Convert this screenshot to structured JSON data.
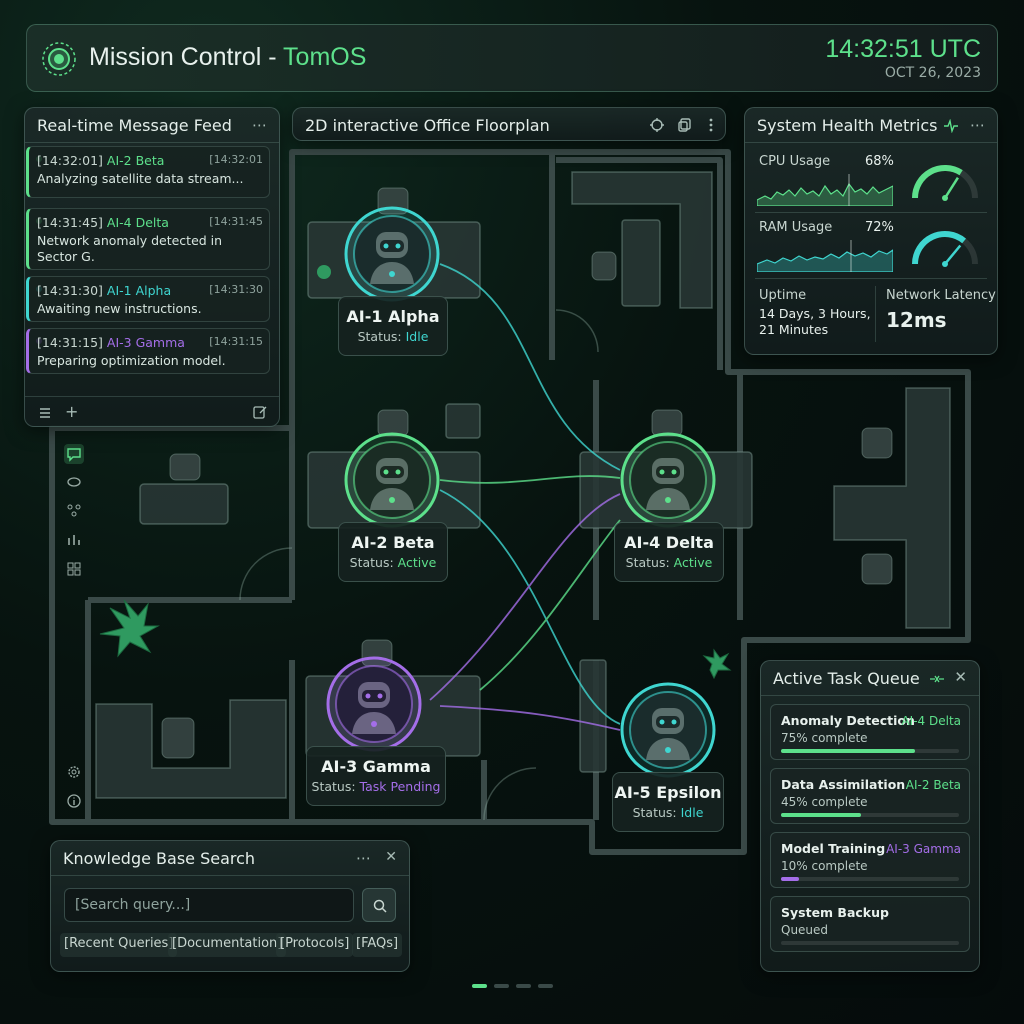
{
  "header": {
    "title_main": "Mission Control - ",
    "title_accent": "TomOS",
    "clock": "14:32:51 UTC",
    "date": "OCT 26, 2023"
  },
  "feed": {
    "title": "Real-time Message Feed",
    "items": [
      {
        "time": "[14:32:01]",
        "agent": "AI-2 Beta",
        "time_right": "[14:32:01",
        "text": "Analyzing satellite data stream...",
        "color": "#5de08b"
      },
      {
        "time": "[14:31:45]",
        "agent": "AI-4 Delta",
        "time_right": "[14:31:45",
        "text": "Network anomaly detected in Sector G.",
        "color": "#5de08b"
      },
      {
        "time": "[14:31:30]",
        "agent": "AI-1 Alpha",
        "time_right": "[14:31:30",
        "text": "Awaiting new instructions.",
        "color": "#3fd6d0"
      },
      {
        "time": "[14:31:15]",
        "agent": "AI-3 Gamma",
        "time_right": "[14:31:15",
        "text": "Preparing optimization model.",
        "color": "#a46ee8"
      }
    ]
  },
  "floorplan": {
    "title": "2D interactive Office Floorplan",
    "status_prefix": "Status: ",
    "agents": [
      {
        "name": "AI-1 Alpha",
        "status": "Idle",
        "color": "#3fd6d0"
      },
      {
        "name": "AI-2 Beta",
        "status": "Active",
        "color": "#5de08b"
      },
      {
        "name": "AI-4 Delta",
        "status": "Active",
        "color": "#5de08b"
      },
      {
        "name": "AI-3 Gamma",
        "status": "Task Pending",
        "color": "#a46ee8"
      },
      {
        "name": "AI-5 Epsilon",
        "status": "Idle",
        "color": "#3fd6d0"
      }
    ]
  },
  "health": {
    "title": "System Health Metrics",
    "cpu_label": "CPU Usage",
    "cpu_value": "68%",
    "cpu_level": 0.68,
    "ram_label": "RAM Usage",
    "ram_value": "72%",
    "ram_level": 0.72,
    "uptime_label": "Uptime",
    "uptime_value_1": "14 Days, 3 Hours,",
    "uptime_value_2": "21 Minutes",
    "latency_label": "Network Latency",
    "latency_value": "12ms"
  },
  "tasks": {
    "title": "Active Task Queue",
    "items": [
      {
        "name": "Anomaly Detection",
        "agent": "AI-4 Delta",
        "progress": "75% complete",
        "level": 0.75,
        "color": "#5de08b"
      },
      {
        "name": "Data Assimilation",
        "agent": "AI-2 Beta",
        "progress": "45% complete",
        "level": 0.45,
        "color": "#5de08b"
      },
      {
        "name": "Model Training",
        "agent": "AI-3 Gamma",
        "progress": "10% complete",
        "level": 0.1,
        "color": "#a46ee8"
      },
      {
        "name": "System Backup",
        "agent": "",
        "progress": "Queued",
        "level": 0,
        "color": "#5de08b"
      }
    ]
  },
  "search": {
    "title": "Knowledge Base Search",
    "placeholder": "[Search query...]",
    "chips": [
      "[Recent Queries]",
      "[Documentation]",
      "[Protocols]",
      "[FAQs]"
    ]
  },
  "colors": {
    "accent_green": "#5de08b",
    "accent_cyan": "#3fd6d0",
    "accent_purple": "#a46ee8"
  }
}
